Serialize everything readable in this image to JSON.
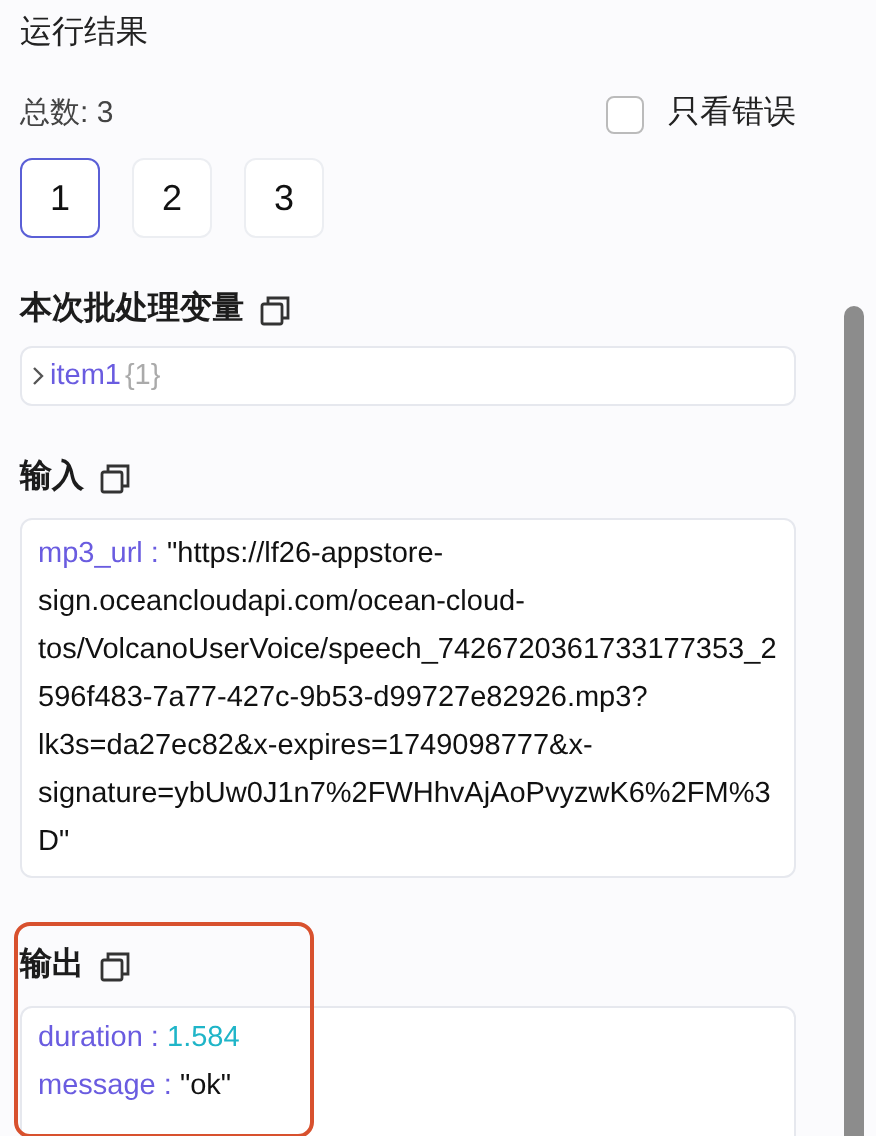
{
  "title": "运行结果",
  "total": "总数: 3",
  "error_filter": {
    "label": "只看错误",
    "checked": false
  },
  "pages": [
    {
      "label": "1",
      "selected": true
    },
    {
      "label": "2",
      "selected": false
    },
    {
      "label": "3",
      "selected": false
    }
  ],
  "batch_variables": {
    "title": "本次批处理变量",
    "items": [
      {
        "key": "item1",
        "summary": "{1}",
        "expanded": false
      }
    ]
  },
  "input": {
    "title": "输入",
    "fields": [
      {
        "key": "mp3_url :",
        "kind": "string",
        "value": "\"https://lf26-appstore-sign.oceancloudapi.com/ocean-cloud-tos/VolcanoUserVoice/speech_7426720361733177353_2596f483-7a77-427c-9b53-d99727e82926.mp3?lk3s=da27ec82&x-expires=1749098777&x-signature=ybUw0J1n7%2FWHhvAjAoPvyzwK6%2FM%3D\""
      }
    ]
  },
  "output": {
    "title": "输出",
    "highlighted": true,
    "fields": [
      {
        "key": "duration :",
        "kind": "number",
        "value": "1.584"
      },
      {
        "key": "message :",
        "kind": "string",
        "value": "\"ok\""
      }
    ]
  }
}
